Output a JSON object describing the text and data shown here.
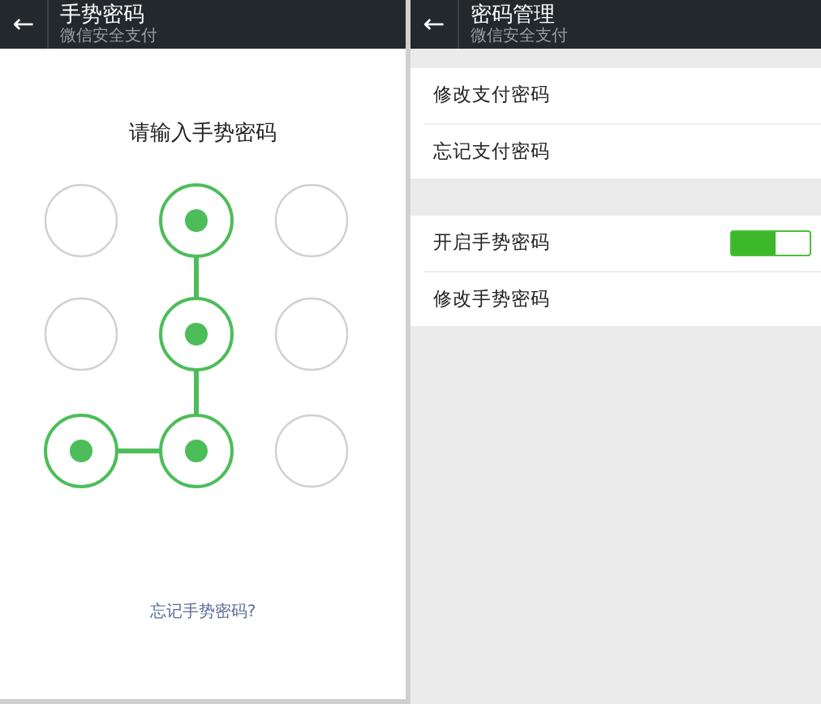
{
  "screens": [
    {
      "kind": "gesture",
      "header": {
        "back": "←",
        "title": "手势密码",
        "subtitle": "微信安全支付"
      },
      "prompt": "请输入手势密码",
      "nodes": [
        {
          "selected": false,
          "line_down": false,
          "line_left": false
        },
        {
          "selected": true,
          "line_down": true,
          "line_left": false
        },
        {
          "selected": false,
          "line_down": false,
          "line_left": false
        },
        {
          "selected": false,
          "line_down": false,
          "line_left": false
        },
        {
          "selected": true,
          "line_down": true,
          "line_left": false
        },
        {
          "selected": false,
          "line_down": false,
          "line_left": false
        },
        {
          "selected": true,
          "line_down": false,
          "line_left": false
        },
        {
          "selected": true,
          "line_down": false,
          "line_left": true
        },
        {
          "selected": false,
          "line_down": false,
          "line_left": false
        }
      ],
      "forgot_link": "忘记手势密码?"
    },
    {
      "kind": "settings",
      "header": {
        "back": "←",
        "title": "密码管理",
        "subtitle": "微信安全支付"
      },
      "groups": [
        {
          "items": [
            {
              "kind": "link",
              "label": "修改支付密码"
            },
            {
              "kind": "link",
              "label": "忘记支付密码"
            }
          ]
        },
        {
          "items": [
            {
              "kind": "toggle",
              "label": "开启手势密码",
              "on": true
            },
            {
              "kind": "link",
              "label": "修改手势密码"
            }
          ]
        }
      ]
    }
  ]
}
